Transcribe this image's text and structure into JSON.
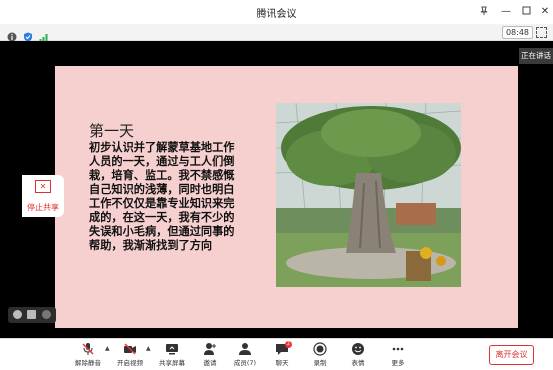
{
  "window": {
    "title": "腾讯会议"
  },
  "status": {
    "time": "08:48"
  },
  "speaking": {
    "label": "正在讲话"
  },
  "slide": {
    "title": "第一天",
    "body": "初步认识并了解蒙草基地工作人员的一天，通过与工人们倒栽，培育、监工。我不禁感慨自己知识的浅薄，同时也明白工作不仅仅是靠专业知识来完成的，在这一天，我有不少的失误和小毛病，但通过同事的帮助，我渐渐找到了方向"
  },
  "share": {
    "stop_label": "停止共享"
  },
  "toolbar": {
    "unmute": "解除静音",
    "start_video": "开启视频",
    "share_screen": "共享屏幕",
    "invite": "邀请",
    "members": "成员(7)",
    "chat": "聊天",
    "chat_badge": "2",
    "record": "录制",
    "reactions": "表情",
    "more": "更多",
    "leave": "离开会议"
  }
}
